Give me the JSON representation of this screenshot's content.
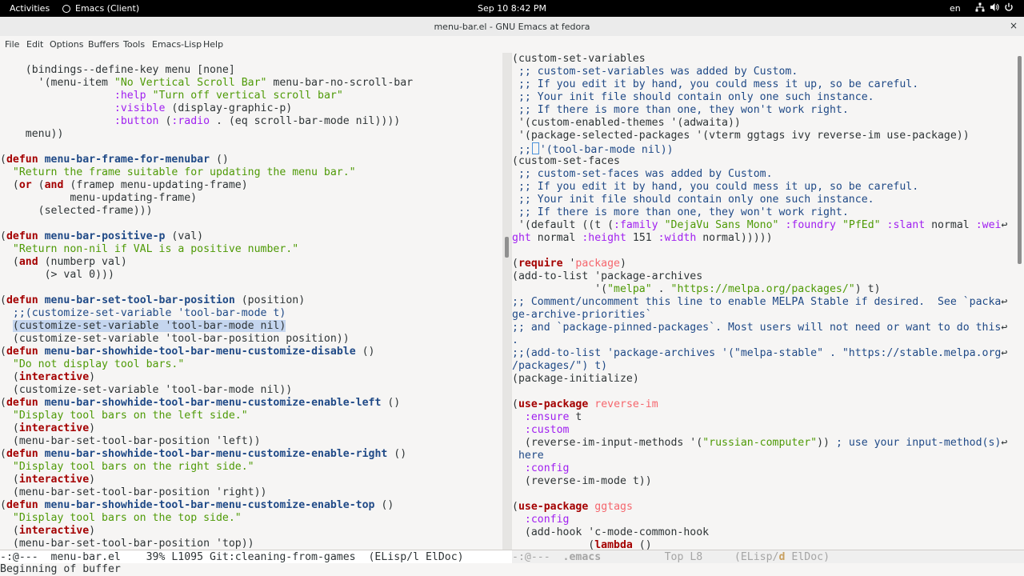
{
  "system_bar": {
    "activities": "Activities",
    "app_name": "Emacs (Client)",
    "clock": "Sep 10  8:42 PM",
    "keyboard_layout": "en"
  },
  "window": {
    "title": "menu-bar.el - GNU Emacs at fedora",
    "close_glyph": "×"
  },
  "menu": [
    "File",
    "Edit",
    "Options",
    "Buffers",
    "Tools",
    "Emacs-Lisp",
    "Help"
  ],
  "left_buffer_lines": [
    [
      [
        "    (bindings--define-key menu [none]",
        ""
      ]
    ],
    [
      [
        "      '(menu-item ",
        ""
      ],
      [
        "\"No Vertical Scroll Bar\"",
        "str"
      ],
      [
        " menu-bar-no-scroll-bar",
        ""
      ]
    ],
    [
      [
        "                  ",
        ""
      ],
      [
        ":help",
        "kk"
      ],
      [
        " ",
        ""
      ],
      [
        "\"Turn off vertical scroll bar\"",
        "str"
      ]
    ],
    [
      [
        "                  ",
        ""
      ],
      [
        ":visible",
        "kk"
      ],
      [
        " (display-graphic-p)",
        ""
      ]
    ],
    [
      [
        "                  ",
        ""
      ],
      [
        ":button",
        "kk"
      ],
      [
        " (",
        ""
      ],
      [
        ":radio",
        "kk"
      ],
      [
        " . (eq scroll-bar-mode nil))))",
        ""
      ]
    ],
    [
      [
        "    menu))",
        ""
      ]
    ],
    [
      [
        "",
        ""
      ]
    ],
    [
      [
        "(",
        ""
      ],
      [
        "defun",
        "kw"
      ],
      [
        " ",
        ""
      ],
      [
        "menu-bar-frame-for-menubar",
        "fn"
      ],
      [
        " ()",
        ""
      ]
    ],
    [
      [
        "  ",
        ""
      ],
      [
        "\"Return the frame suitable for updating the menu bar.\"",
        "str"
      ]
    ],
    [
      [
        "  (",
        ""
      ],
      [
        "or",
        "kw"
      ],
      [
        " (",
        ""
      ],
      [
        "and",
        "kw"
      ],
      [
        " (framep menu-updating-frame)",
        ""
      ]
    ],
    [
      [
        "           menu-updating-frame)",
        ""
      ]
    ],
    [
      [
        "      (selected-frame)))",
        ""
      ]
    ],
    [
      [
        "",
        ""
      ]
    ],
    [
      [
        "(",
        ""
      ],
      [
        "defun",
        "kw"
      ],
      [
        " ",
        ""
      ],
      [
        "menu-bar-positive-p",
        "fn"
      ],
      [
        " (val)",
        ""
      ]
    ],
    [
      [
        "  ",
        ""
      ],
      [
        "\"Return non-nil if VAL is a positive number.\"",
        "str"
      ]
    ],
    [
      [
        "  (",
        ""
      ],
      [
        "and",
        "kw"
      ],
      [
        " (numberp val)",
        ""
      ]
    ],
    [
      [
        "       (> val 0)))",
        ""
      ]
    ],
    [
      [
        "",
        ""
      ]
    ],
    [
      [
        "(",
        ""
      ],
      [
        "defun",
        "kw"
      ],
      [
        " ",
        ""
      ],
      [
        "menu-bar-set-tool-bar-position",
        "fn"
      ],
      [
        " (position)",
        ""
      ]
    ],
    [
      [
        "  ",
        ""
      ],
      [
        ";;(customize-set-variable 'tool-bar-mode t)",
        "cm"
      ]
    ],
    [
      [
        "  ",
        ""
      ],
      [
        "(customize-set-variable 'tool-bar-mode nil)",
        "hl"
      ]
    ],
    [
      [
        "  (customize-set-variable 'tool-bar-position position))",
        ""
      ]
    ],
    [
      [
        "(",
        ""
      ],
      [
        "defun",
        "kw"
      ],
      [
        " ",
        ""
      ],
      [
        "menu-bar-showhide-tool-bar-menu-customize-disable",
        "fn"
      ],
      [
        " ()",
        ""
      ]
    ],
    [
      [
        "  ",
        ""
      ],
      [
        "\"Do not display tool bars.\"",
        "str"
      ]
    ],
    [
      [
        "  (",
        ""
      ],
      [
        "interactive",
        "kw"
      ],
      [
        ")",
        ""
      ]
    ],
    [
      [
        "  (customize-set-variable 'tool-bar-mode nil))",
        ""
      ]
    ],
    [
      [
        "(",
        ""
      ],
      [
        "defun",
        "kw"
      ],
      [
        " ",
        ""
      ],
      [
        "menu-bar-showhide-tool-bar-menu-customize-enable-left",
        "fn"
      ],
      [
        " ()",
        ""
      ]
    ],
    [
      [
        "  ",
        ""
      ],
      [
        "\"Display tool bars on the left side.\"",
        "str"
      ]
    ],
    [
      [
        "  (",
        ""
      ],
      [
        "interactive",
        "kw"
      ],
      [
        ")",
        ""
      ]
    ],
    [
      [
        "  (menu-bar-set-tool-bar-position 'left))",
        ""
      ]
    ],
    [
      [
        "(",
        ""
      ],
      [
        "defun",
        "kw"
      ],
      [
        " ",
        ""
      ],
      [
        "menu-bar-showhide-tool-bar-menu-customize-enable-right",
        "fn"
      ],
      [
        " ()",
        ""
      ]
    ],
    [
      [
        "  ",
        ""
      ],
      [
        "\"Display tool bars on the right side.\"",
        "str"
      ]
    ],
    [
      [
        "  (",
        ""
      ],
      [
        "interactive",
        "kw"
      ],
      [
        ")",
        ""
      ]
    ],
    [
      [
        "  (menu-bar-set-tool-bar-position 'right))",
        ""
      ]
    ],
    [
      [
        "(",
        ""
      ],
      [
        "defun",
        "kw"
      ],
      [
        " ",
        ""
      ],
      [
        "menu-bar-showhide-tool-bar-menu-customize-enable-top",
        "fn"
      ],
      [
        " ()",
        ""
      ]
    ],
    [
      [
        "  ",
        ""
      ],
      [
        "\"Display tool bars on the top side.\"",
        "str"
      ]
    ],
    [
      [
        "  (",
        ""
      ],
      [
        "interactive",
        "kw"
      ],
      [
        ")",
        ""
      ]
    ],
    [
      [
        "  (menu-bar-set-tool-bar-position 'top))",
        ""
      ]
    ]
  ],
  "right_buffer_lines": [
    [
      [
        "(custom-set-variables",
        ""
      ]
    ],
    [
      [
        " ",
        ""
      ],
      [
        ";; custom-set-variables was added by Custom.",
        "cm"
      ]
    ],
    [
      [
        " ",
        ""
      ],
      [
        ";; If you edit it by hand, you could mess it up, so be careful.",
        "cm"
      ]
    ],
    [
      [
        " ",
        ""
      ],
      [
        ";; Your init file should contain only one such instance.",
        "cm"
      ]
    ],
    [
      [
        " ",
        ""
      ],
      [
        ";; If there is more than one, they won't work right.",
        "cm"
      ]
    ],
    [
      [
        " '(custom-enabled-themes '(adwaita))",
        ""
      ]
    ],
    [
      [
        " '(package-selected-packages '(vterm ggtags ivy reverse-im use-package))",
        ""
      ]
    ],
    [
      [
        " ",
        ""
      ],
      [
        ";;",
        "cm"
      ],
      [
        "CURSOR",
        "cursor"
      ],
      [
        "'(tool-bar-mode nil))",
        "cm"
      ]
    ],
    [
      [
        "(custom-set-faces",
        ""
      ]
    ],
    [
      [
        " ",
        ""
      ],
      [
        ";; custom-set-faces was added by Custom.",
        "cm"
      ]
    ],
    [
      [
        " ",
        ""
      ],
      [
        ";; If you edit it by hand, you could mess it up, so be careful.",
        "cm"
      ]
    ],
    [
      [
        " ",
        ""
      ],
      [
        ";; Your init file should contain only one such instance.",
        "cm"
      ]
    ],
    [
      [
        " ",
        ""
      ],
      [
        ";; If there is more than one, they won't work right.",
        "cm"
      ]
    ],
    [
      [
        " '(default ((t (",
        ""
      ],
      [
        ":family",
        "kk"
      ],
      [
        " ",
        ""
      ],
      [
        "\"DejaVu Sans Mono\"",
        "str"
      ],
      [
        " ",
        ""
      ],
      [
        ":foundry",
        "kk"
      ],
      [
        " ",
        ""
      ],
      [
        "\"PfEd\"",
        "str"
      ],
      [
        " ",
        ""
      ],
      [
        ":slant",
        "kk"
      ],
      [
        " normal ",
        ""
      ],
      [
        ":wei",
        "kk"
      ],
      [
        "↩",
        "wrap"
      ]
    ],
    [
      [
        "ght",
        "kk"
      ],
      [
        " normal ",
        ""
      ],
      [
        ":height",
        "kk"
      ],
      [
        " 151 ",
        ""
      ],
      [
        ":width",
        "kk"
      ],
      [
        " normal)))))",
        ""
      ]
    ],
    [
      [
        "",
        ""
      ]
    ],
    [
      [
        "(",
        ""
      ],
      [
        "require",
        "kw"
      ],
      [
        " '",
        ""
      ],
      [
        "package",
        "cst"
      ],
      [
        ")",
        ""
      ]
    ],
    [
      [
        "(add-to-list 'package-archives",
        ""
      ]
    ],
    [
      [
        "             '(",
        ""
      ],
      [
        "\"melpa\"",
        "str"
      ],
      [
        " . ",
        ""
      ],
      [
        "\"https://melpa.org/packages/\"",
        "str"
      ],
      [
        ") t)",
        ""
      ]
    ],
    [
      [
        ";; Comment/uncomment this line to enable MELPA Stable if desired.  See `packa",
        "cm"
      ],
      [
        "↩",
        "wrap"
      ]
    ],
    [
      [
        "ge-archive-priorities`",
        "cm"
      ]
    ],
    [
      [
        ";; and `package-pinned-packages`. Most users will not need or want to do this",
        "cm"
      ],
      [
        "↩",
        "wrap"
      ]
    ],
    [
      [
        ".",
        "cm"
      ]
    ],
    [
      [
        ";;(add-to-list 'package-archives '(\"melpa-stable\" . \"https://stable.melpa.org",
        "cm"
      ],
      [
        "↩",
        "wrap"
      ]
    ],
    [
      [
        "/packages/\") t)",
        "cm"
      ]
    ],
    [
      [
        "(package-initialize)",
        ""
      ]
    ],
    [
      [
        "",
        ""
      ]
    ],
    [
      [
        "(",
        ""
      ],
      [
        "use-package",
        "kw"
      ],
      [
        " ",
        ""
      ],
      [
        "reverse-im",
        "cst"
      ]
    ],
    [
      [
        "  ",
        ""
      ],
      [
        ":ensure",
        "kk"
      ],
      [
        " t",
        ""
      ]
    ],
    [
      [
        "  ",
        ""
      ],
      [
        ":custom",
        "kk"
      ]
    ],
    [
      [
        "  (reverse-im-input-methods '(",
        ""
      ],
      [
        "\"russian-computer\"",
        "str"
      ],
      [
        ")) ",
        ""
      ],
      [
        "; use your input-method(s)",
        "cm"
      ],
      [
        "↩",
        "wrap"
      ]
    ],
    [
      [
        " here",
        "cm"
      ]
    ],
    [
      [
        "  ",
        ""
      ],
      [
        ":config",
        "kk"
      ]
    ],
    [
      [
        "  (reverse-im-mode t))",
        ""
      ]
    ],
    [
      [
        "",
        ""
      ]
    ],
    [
      [
        "(",
        ""
      ],
      [
        "use-package",
        "kw"
      ],
      [
        " ",
        ""
      ],
      [
        "ggtags",
        "cst"
      ]
    ],
    [
      [
        "  ",
        ""
      ],
      [
        ":config",
        "kk"
      ]
    ],
    [
      [
        "  (add-hook 'c-mode-common-hook",
        ""
      ]
    ],
    [
      [
        "            (",
        ""
      ],
      [
        "lambda",
        "kw"
      ],
      [
        " ()",
        ""
      ]
    ]
  ],
  "left_modeline": "-:@---  menu-bar.el    39% L1095 Git:cleaning-from-games  (ELisp/l ElDoc)",
  "right_modeline_parts": [
    [
      "-:@---  ",
      ""
    ],
    [
      ".emacs",
      "b"
    ],
    [
      "          Top L8     (ELisp/",
      ""
    ],
    [
      "d",
      "d"
    ],
    [
      " ElDoc)",
      ""
    ]
  ],
  "minibuffer": "Beginning of buffer",
  "colors": {
    "keyword": "#a40000",
    "function_name": "#204a87",
    "string": "#4e9a06",
    "comment": "#204a87",
    "keyword_arg": "#a020f0",
    "constant": "#f5666d",
    "region_highlight": "#c5d6ef"
  }
}
